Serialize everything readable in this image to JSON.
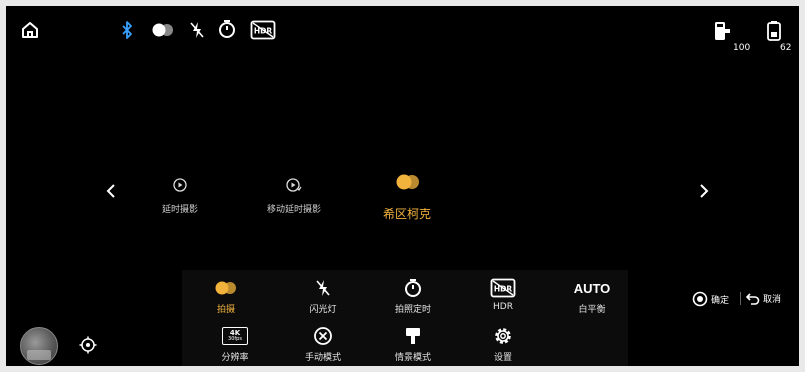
{
  "colors": {
    "accent": "#f2b33d",
    "background": "#000000"
  },
  "topbar": {
    "home_icon": "home-icon",
    "status_icons": [
      "bluetooth-icon",
      "toggle-mode-icon",
      "flash-off-icon",
      "timer-icon",
      "hdr-off-icon"
    ],
    "battery_left": "100",
    "battery_right": "62"
  },
  "modes": {
    "items": [
      {
        "label": "延时摄影",
        "icon": "timelapse-icon"
      },
      {
        "label": "移动延时摄影",
        "icon": "motion-timelapse-icon"
      },
      {
        "label": "希区柯克",
        "icon": "hitchcock-icon",
        "selected": true
      }
    ]
  },
  "settings": {
    "row1": [
      {
        "label": "拍摄",
        "icon": "shoot-icon",
        "active": true
      },
      {
        "label": "闪光灯",
        "icon": "flash-off-icon"
      },
      {
        "label": "拍照定时",
        "icon": "timer-icon"
      },
      {
        "label": "HDR",
        "icon": "hdr-icon"
      },
      {
        "label": "白平衡",
        "value": "AUTO"
      }
    ],
    "row2": [
      {
        "label": "分辨率",
        "icon": "resolution-icon",
        "badge_top": "4K",
        "badge_bottom": "30fps"
      },
      {
        "label": "手动模式",
        "icon": "manual-mode-icon"
      },
      {
        "label": "情景模式",
        "icon": "scene-mode-icon"
      },
      {
        "label": "设置",
        "icon": "gear-icon"
      }
    ]
  },
  "actions": {
    "confirm": "确定",
    "cancel": "取消"
  }
}
